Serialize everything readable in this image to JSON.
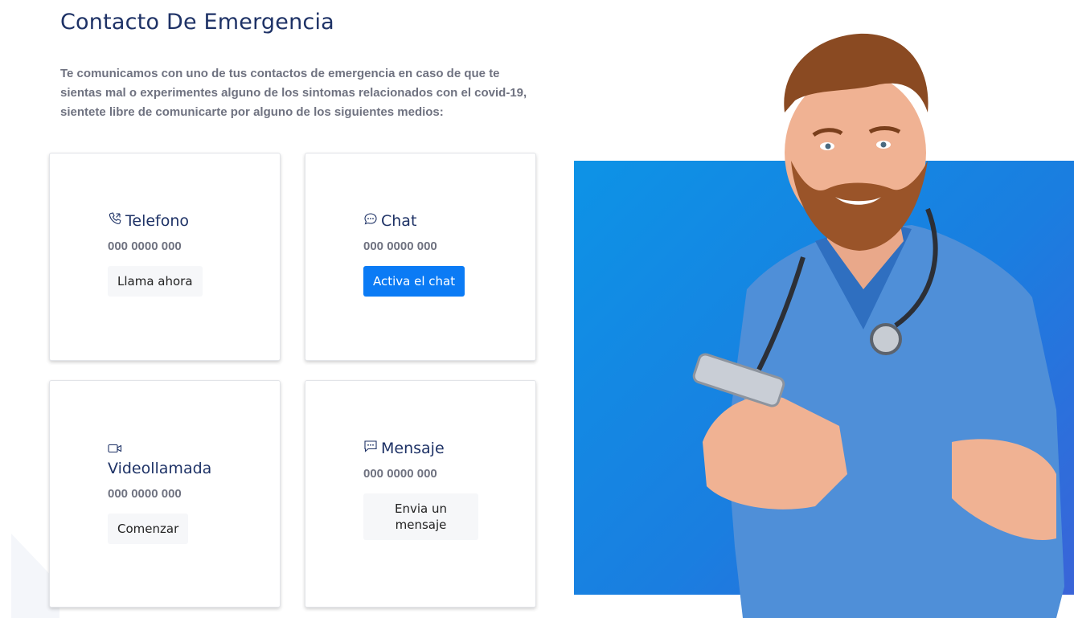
{
  "header": {
    "title": "Contacto De Emergencia",
    "intro": "Te comunicamos con uno de tus contactos de emergencia en caso de que te sientas mal o experimentes alguno de los sintomas relacionados con el covid-19, sientete libre de comunicarte por alguno de los siguientes medios:"
  },
  "cards": {
    "telefono": {
      "icon": "phone-icon",
      "title": "Telefono",
      "number": "000 0000 000",
      "button": "Llama ahora"
    },
    "chat": {
      "icon": "chat-bubble-icon",
      "title": "Chat",
      "number": "000 0000 000",
      "button": "Activa el chat"
    },
    "video": {
      "icon": "video-camera-icon",
      "title": "Videollamada",
      "number": "000 0000 000",
      "button": "Comenzar"
    },
    "mensaje": {
      "icon": "message-icon",
      "title": "Mensaje",
      "number": "000 0000 000",
      "button": "Envia un mensaje"
    }
  },
  "colors": {
    "heading": "#1e3266",
    "muted": "#6f7280",
    "primary_button": "#0b7bf5",
    "hero_gradient_start": "#0d93e6",
    "hero_gradient_end": "#3a64d8"
  }
}
